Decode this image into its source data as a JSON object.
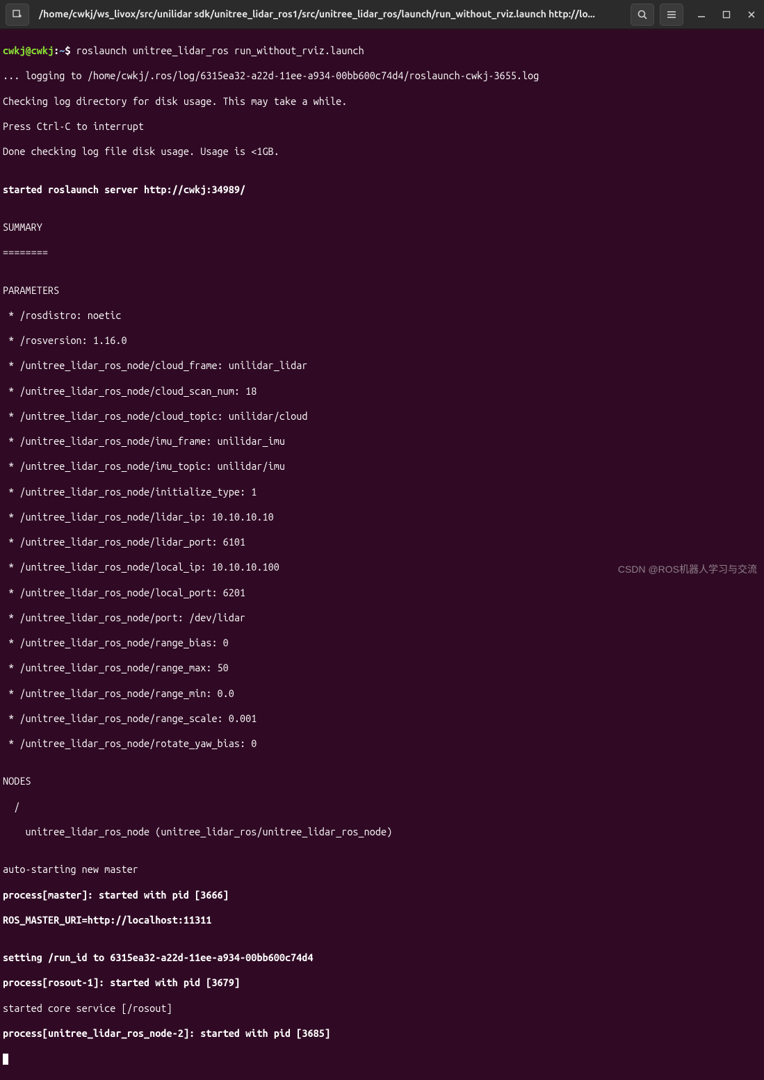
{
  "titlebar": {
    "title": "/home/cwkj/ws_livox/src/unilidar sdk/unitree_lidar_ros1/src/unitree_lidar_ros/launch/run_without_rviz.launch http://lo..."
  },
  "prompt": {
    "userhost": "cwkj@cwkj",
    "sep1": ":",
    "path": "~",
    "sep2": "$ ",
    "command": "roslaunch unitree_lidar_ros run_without_rviz.launch"
  },
  "lines": {
    "l1": "... logging to /home/cwkj/.ros/log/6315ea32-a22d-11ee-a934-00bb600c74d4/roslaunch-cwkj-3655.log",
    "l2": "Checking log directory for disk usage. This may take a while.",
    "l3": "Press Ctrl-C to interrupt",
    "l4": "Done checking log file disk usage. Usage is <1GB.",
    "l5": "",
    "l6": "started roslaunch server http://cwkj:34989/",
    "l7": "",
    "l8": "SUMMARY",
    "l9": "========",
    "l10": "",
    "l11": "PARAMETERS",
    "p1": " * /rosdistro: noetic",
    "p2": " * /rosversion: 1.16.0",
    "p3": " * /unitree_lidar_ros_node/cloud_frame: unilidar_lidar",
    "p4": " * /unitree_lidar_ros_node/cloud_scan_num: 18",
    "p5": " * /unitree_lidar_ros_node/cloud_topic: unilidar/cloud",
    "p6": " * /unitree_lidar_ros_node/imu_frame: unilidar_imu",
    "p7": " * /unitree_lidar_ros_node/imu_topic: unilidar/imu",
    "p8": " * /unitree_lidar_ros_node/initialize_type: 1",
    "p9": " * /unitree_lidar_ros_node/lidar_ip: 10.10.10.10",
    "p10": " * /unitree_lidar_ros_node/lidar_port: 6101",
    "p11": " * /unitree_lidar_ros_node/local_ip: 10.10.10.100",
    "p12": " * /unitree_lidar_ros_node/local_port: 6201",
    "p13": " * /unitree_lidar_ros_node/port: /dev/lidar",
    "p14": " * /unitree_lidar_ros_node/range_bias: 0",
    "p15": " * /unitree_lidar_ros_node/range_max: 50",
    "p16": " * /unitree_lidar_ros_node/range_min: 0.0",
    "p17": " * /unitree_lidar_ros_node/range_scale: 0.001",
    "p18": " * /unitree_lidar_ros_node/rotate_yaw_bias: 0",
    "l12": "",
    "l13": "NODES",
    "l14": "  /",
    "l15": "    unitree_lidar_ros_node (unitree_lidar_ros/unitree_lidar_ros_node)",
    "l16": "",
    "l17": "auto-starting new master",
    "l18": "process[master]: started with pid [3666]",
    "l19": "ROS_MASTER_URI=http://localhost:11311",
    "l20": "",
    "l21": "setting /run_id to 6315ea32-a22d-11ee-a934-00bb600c74d4",
    "l22": "process[rosout-1]: started with pid [3679]",
    "l23": "started core service [/rosout]",
    "l24": "process[unitree_lidar_ros_node-2]: started with pid [3685]"
  },
  "watermark": "CSDN @ROS机器人学习与交流"
}
